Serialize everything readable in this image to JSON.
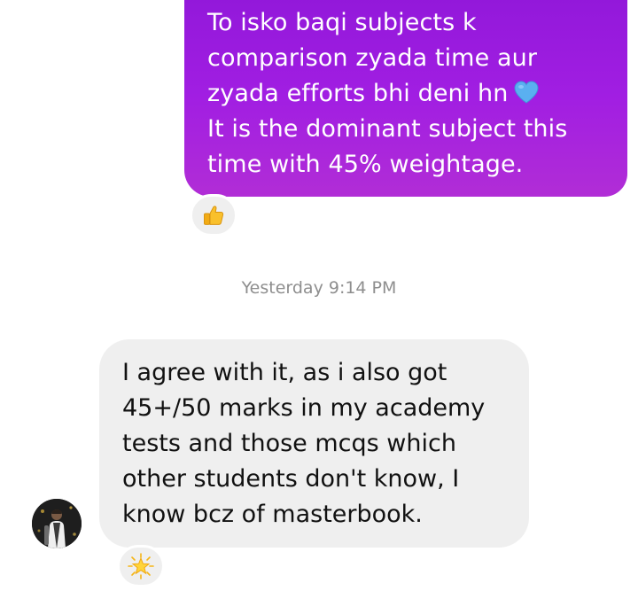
{
  "outgoing_message": {
    "lines": [
      "To isko baqi subjects k",
      "comparison zyada time aur",
      "zyada efforts bhi deni hn",
      "It is the dominant subject this",
      "time with 45% weightage."
    ],
    "emoji": "blue-heart",
    "bubble_gradient": [
      "#8f17d8",
      "#b12dd6"
    ],
    "reaction": "thumbs-up"
  },
  "timestamp": "Yesterday 9:14 PM",
  "incoming_message": {
    "lines": [
      "I agree with it, as i also got",
      "45+/50 marks in my academy",
      "tests and those mcqs which",
      "other students don't know, I",
      "know bcz of masterbook."
    ],
    "bubble_color": "#efefef",
    "reaction": "glowing-star"
  },
  "contact": {
    "avatar": "contact-avatar"
  }
}
